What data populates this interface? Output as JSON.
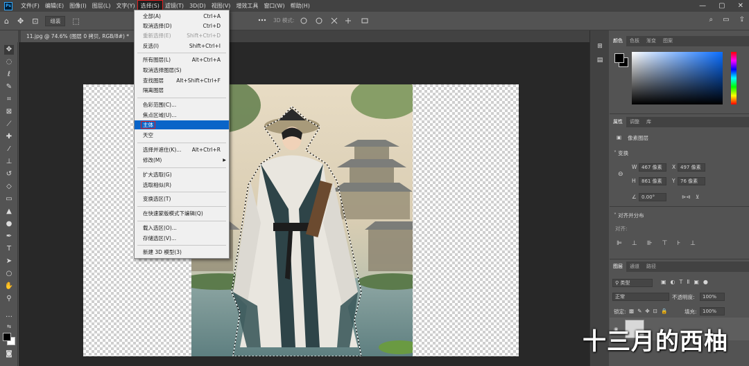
{
  "menubar": {
    "items": [
      "文件(F)",
      "编辑(E)",
      "图像(I)",
      "图层(L)",
      "文字(Y)",
      "选择(S)",
      "滤镜(T)",
      "3D(D)",
      "视图(V)",
      "增效工具",
      "窗口(W)",
      "帮助(H)"
    ],
    "logo": "Ps",
    "minimize": "—",
    "maximize": "▢",
    "close": "✕"
  },
  "options": {
    "align_mode": "组装",
    "threed_mode": "3D 模式:"
  },
  "document": {
    "tab_title": "11.jpg @ 74.6% (图层 0 拷贝, RGB/8#) *",
    "tab_close": "×"
  },
  "select_menu": {
    "items": [
      {
        "label": "全部(A)",
        "shortcut": "Ctrl+A"
      },
      {
        "label": "取消选择(D)",
        "shortcut": "Ctrl+D"
      },
      {
        "label": "重新选择(E)",
        "shortcut": "Shift+Ctrl+D",
        "disabled": true
      },
      {
        "label": "反选(I)",
        "shortcut": "Shift+Ctrl+I"
      },
      {
        "label": "所有图层(L)",
        "shortcut": "Alt+Ctrl+A"
      },
      {
        "label": "取消选择图层(S)",
        "shortcut": ""
      },
      {
        "label": "查找图层",
        "shortcut": "Alt+Shift+Ctrl+F"
      },
      {
        "label": "隔离图层",
        "shortcut": ""
      },
      {
        "label": "色彩范围(C)...",
        "shortcut": ""
      },
      {
        "label": "焦点区域(U)...",
        "shortcut": ""
      },
      {
        "label": "主体",
        "shortcut": "",
        "highlighted": true
      },
      {
        "label": "天空",
        "shortcut": ""
      },
      {
        "label": "选择并遮住(K)...",
        "shortcut": "Alt+Ctrl+R"
      },
      {
        "label": "修改(M)",
        "shortcut": "",
        "submenu": true
      },
      {
        "label": "扩大选取(G)",
        "shortcut": ""
      },
      {
        "label": "选取相似(R)",
        "shortcut": ""
      },
      {
        "label": "变换选区(T)",
        "shortcut": ""
      },
      {
        "label": "在快速蒙版模式下编辑(Q)",
        "shortcut": ""
      },
      {
        "label": "载入选区(O)...",
        "shortcut": ""
      },
      {
        "label": "存储选区(V)...",
        "shortcut": ""
      },
      {
        "label": "新建 3D 模型(3)",
        "shortcut": ""
      }
    ]
  },
  "color_panel": {
    "tabs": [
      "颜色",
      "色板",
      "渐变",
      "图案"
    ]
  },
  "properties_panel": {
    "tabs": [
      "属性",
      "调整",
      "库"
    ],
    "layer_type": "像素图层",
    "transform_header": "变换",
    "w_label": "W",
    "w_value": "467 像素",
    "x_label": "X",
    "x_value": "497 像素",
    "h_label": "H",
    "h_value": "861 像素",
    "y_label": "Y",
    "y_value": "76 像素",
    "angle_value": "0.00°",
    "align_header": "对齐并分布",
    "align_label": "对齐:"
  },
  "layers_panel": {
    "tabs": [
      "图层",
      "通道",
      "路径"
    ],
    "filter_type": "类型",
    "blend_mode": "正常",
    "opacity_label": "不透明度:",
    "opacity_value": "100%",
    "lock_label": "锁定:",
    "fill_label": "填充:",
    "fill_value": "100%"
  },
  "watermark": "十三月的西柚"
}
